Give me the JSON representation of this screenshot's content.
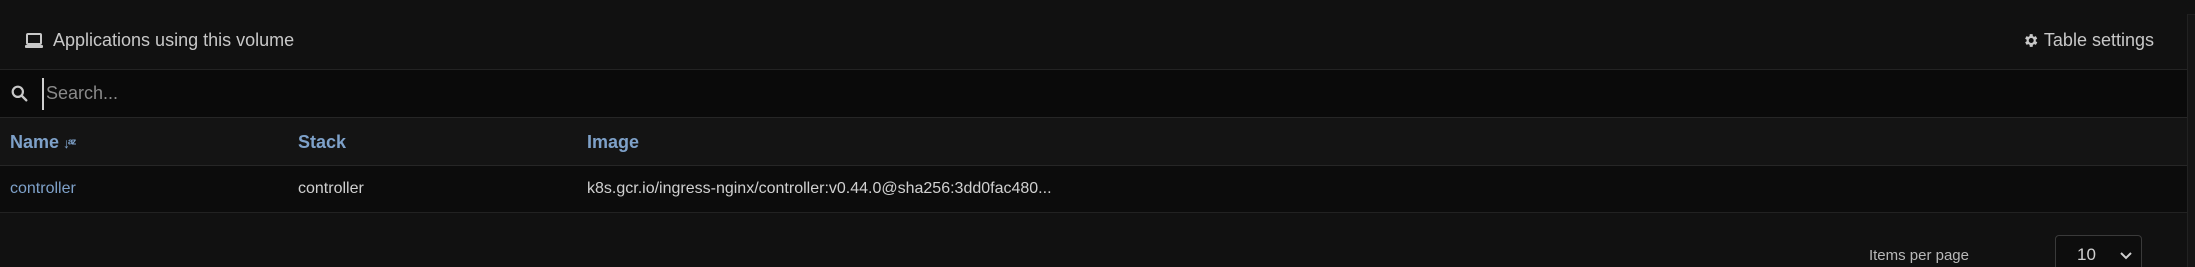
{
  "panel": {
    "title": "Applications using this volume",
    "table_settings_label": "Table settings"
  },
  "search": {
    "placeholder": "Search...",
    "value": ""
  },
  "table": {
    "columns": [
      "Name",
      "Stack",
      "Image"
    ],
    "rows": [
      {
        "name": "controller",
        "stack": "controller",
        "image": "k8s.gcr.io/ingress-nginx/controller:v0.44.0@sha256:3dd0fac480..."
      }
    ],
    "sort_column": "Name",
    "sort_direction": "ascending"
  },
  "pagination": {
    "items_per_page_label": "Items per page",
    "items_per_page_value": "10"
  },
  "icons": {
    "title_icon": "laptop-icon",
    "settings_icon": "gear-icon",
    "search_icon": "search-icon",
    "sort_icon": "sort-alpha-down-icon",
    "select_icon": "chevron-down-icon"
  },
  "colors": {
    "accent": "#7ea1c9",
    "background": "#0f0f0f",
    "text": "#d0d0d0"
  }
}
